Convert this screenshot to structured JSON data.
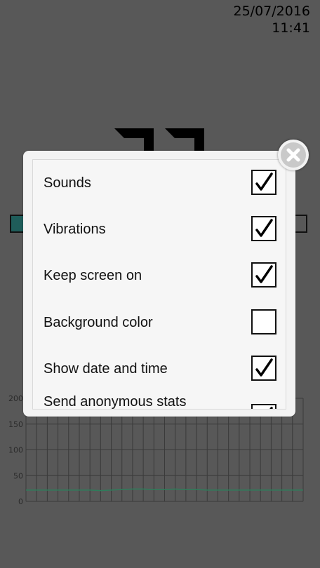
{
  "status": {
    "date": "25/07/2016",
    "time": "11:41"
  },
  "chart_data": {
    "type": "line",
    "y_ticks": [
      "200",
      "150",
      "100",
      "50",
      "0"
    ],
    "ylim": [
      0,
      200
    ],
    "grid": true,
    "series": [
      {
        "color": "#2e7d5b",
        "values": [
          22,
          22,
          22,
          22,
          22,
          22,
          22,
          21,
          22,
          23,
          24,
          24,
          23,
          23,
          24,
          23,
          23,
          22,
          22,
          22,
          22,
          22,
          22,
          22,
          22,
          22,
          22
        ]
      }
    ]
  },
  "settings": {
    "items": [
      {
        "label": "Sounds",
        "checked": true
      },
      {
        "label": "Vibrations",
        "checked": true
      },
      {
        "label": "Keep screen on",
        "checked": true
      },
      {
        "label": "Background color",
        "checked": false
      },
      {
        "label": "Show date and time",
        "checked": true
      },
      {
        "label": "Send anonymous stats",
        "checked": true
      }
    ]
  },
  "colors": {
    "background": "#585858",
    "dialog": "#f3f3f3",
    "chart_line": "#2e7d5b"
  },
  "icons": {
    "close": "close-icon",
    "check": "checkmark-icon"
  }
}
